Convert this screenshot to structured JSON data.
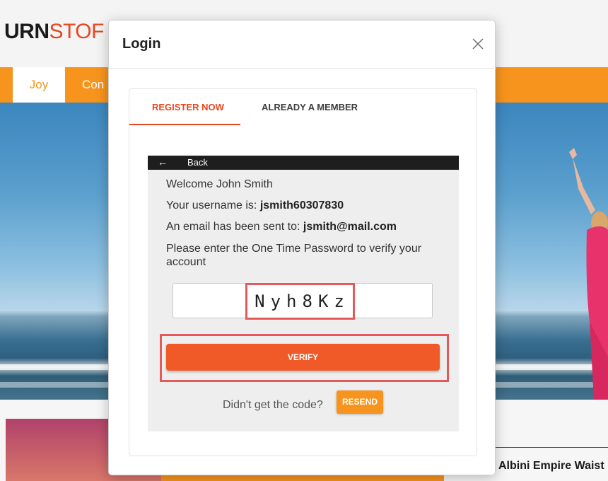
{
  "site": {
    "logo_part1": "URN",
    "logo_part2": "STOF",
    "nav": [
      "Joy",
      "Con"
    ],
    "product_title": "Albini Empire Waist"
  },
  "modal": {
    "title": "Login",
    "tabs": [
      "REGISTER NOW",
      "ALREADY A MEMBER"
    ],
    "active_tab": "REGISTER NOW",
    "back_label": "Back",
    "welcome": "Welcome John Smith",
    "username_prefix": "Your username is: ",
    "username": "jsmith60307830",
    "email_prefix": "An email has been sent to: ",
    "email": "jsmith@mail.com",
    "instruction": "Please enter the One Time Password to verify your account",
    "otp_value": "Nyh8Kz",
    "verify_label": "VERIFY",
    "resend_prompt": "Didn't get the code?",
    "resend_label": "RESEND"
  },
  "colors": {
    "accent": "#f05a28",
    "orange": "#f7941d",
    "highlight": "#e45a5a"
  }
}
